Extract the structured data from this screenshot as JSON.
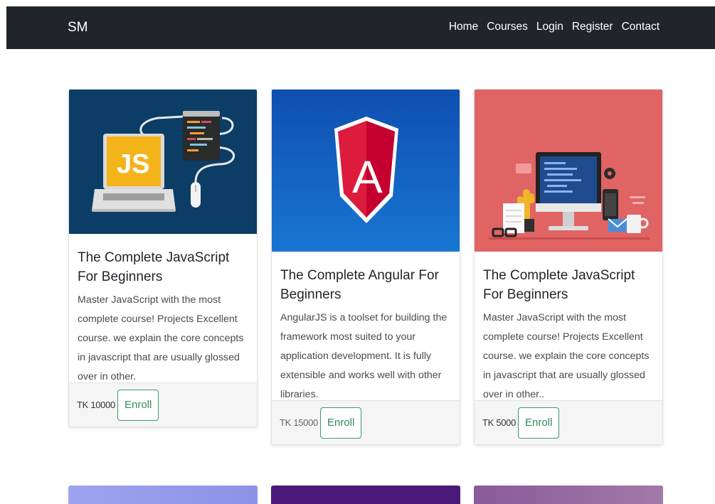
{
  "nav": {
    "brand": "SM",
    "links": [
      "Home",
      "Courses",
      "Login",
      "Register",
      "Contact"
    ]
  },
  "courses": [
    {
      "title": "The Complete JavaScript For Beginners",
      "description": "Master JavaScript with the most complete course! Projects Excellent course. we explain the core concepts in javascript that are usually glossed over in other.",
      "price": "TK 10000",
      "enroll_label": "Enroll",
      "image_bg": "#0b3d66",
      "image_badge": "JS"
    },
    {
      "title": "The Complete Angular For Beginners",
      "description": "AngularJS is a toolset for building the framework most suited to your application development. It is fully extensible and works well with other libraries.",
      "price": "TK 15000",
      "enroll_label": "Enroll",
      "image_bg": "#1565c0",
      "image_badge": "A"
    },
    {
      "title": "The Complete JavaScript For Beginners",
      "description": "Master JavaScript with the most complete course! Projects Excellent course. we explain the core concepts in javascript that are usually glossed over in other..",
      "price": "TK 5000",
      "enroll_label": "Enroll",
      "image_bg": "#e06464"
    }
  ],
  "colors": {
    "navbar": "#212529",
    "enroll_border": "#3d9b6a",
    "bottom_card_1": "#9b9ee8",
    "bottom_card_2": "#4a1a7a",
    "bottom_card_3": "#8a5a9a"
  }
}
